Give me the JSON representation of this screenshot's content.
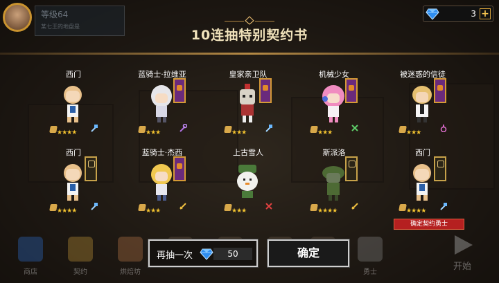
{
  "player": {
    "level": "等级64",
    "subtitle": "某七王的地盘是"
  },
  "currency": {
    "gems": "3",
    "plus": "+"
  },
  "title": "10连抽特别契约书",
  "cards": [
    {
      "name": "西门",
      "stars": "★★★★",
      "banner": "purple"
    },
    {
      "name": "蓝骑士·拉维亚",
      "stars": "★★★",
      "banner": "purple"
    },
    {
      "name": "皇家亲卫队",
      "stars": "★★★",
      "banner": "purple"
    },
    {
      "name": "机械少女",
      "stars": "★★★",
      "banner": "purple"
    },
    {
      "name": "被迷惑的信徒",
      "stars": "★★★",
      "banner": "purple"
    },
    {
      "name": "西门",
      "stars": "★★★★",
      "banner": "gold"
    },
    {
      "name": "蓝骑士·杰西",
      "stars": "★★★",
      "banner": "purple"
    },
    {
      "name": "上古雪人",
      "stars": "★★★",
      "banner": "none"
    },
    {
      "name": "斯派洛",
      "stars": "★★★★",
      "banner": "gold"
    },
    {
      "name": "西门",
      "stars": "★★★★",
      "banner": "gold"
    }
  ],
  "confirm_badge": "确定契约勇士",
  "nav": [
    {
      "label": "商店",
      "icon": "shop-icon"
    },
    {
      "label": "契约",
      "icon": "contract-icon"
    },
    {
      "label": "烘焙坊",
      "icon": "bakery-icon"
    },
    {
      "label": "",
      "icon": "building-icon"
    },
    {
      "label": "",
      "icon": "hall-icon"
    },
    {
      "label": "",
      "icon": "tower-icon"
    },
    {
      "label": "",
      "icon": "training-icon"
    },
    {
      "label": "勇士",
      "icon": "hero-icon"
    }
  ],
  "start_label": "开始",
  "buttons": {
    "redraw": "再抽一次",
    "redraw_cost": "50",
    "confirm": "确定"
  },
  "colors": {
    "gem": "#2f8ef0",
    "gold": "#d59a36",
    "banner_purple": "#6a2a7c",
    "badge_red": "#b52020"
  }
}
